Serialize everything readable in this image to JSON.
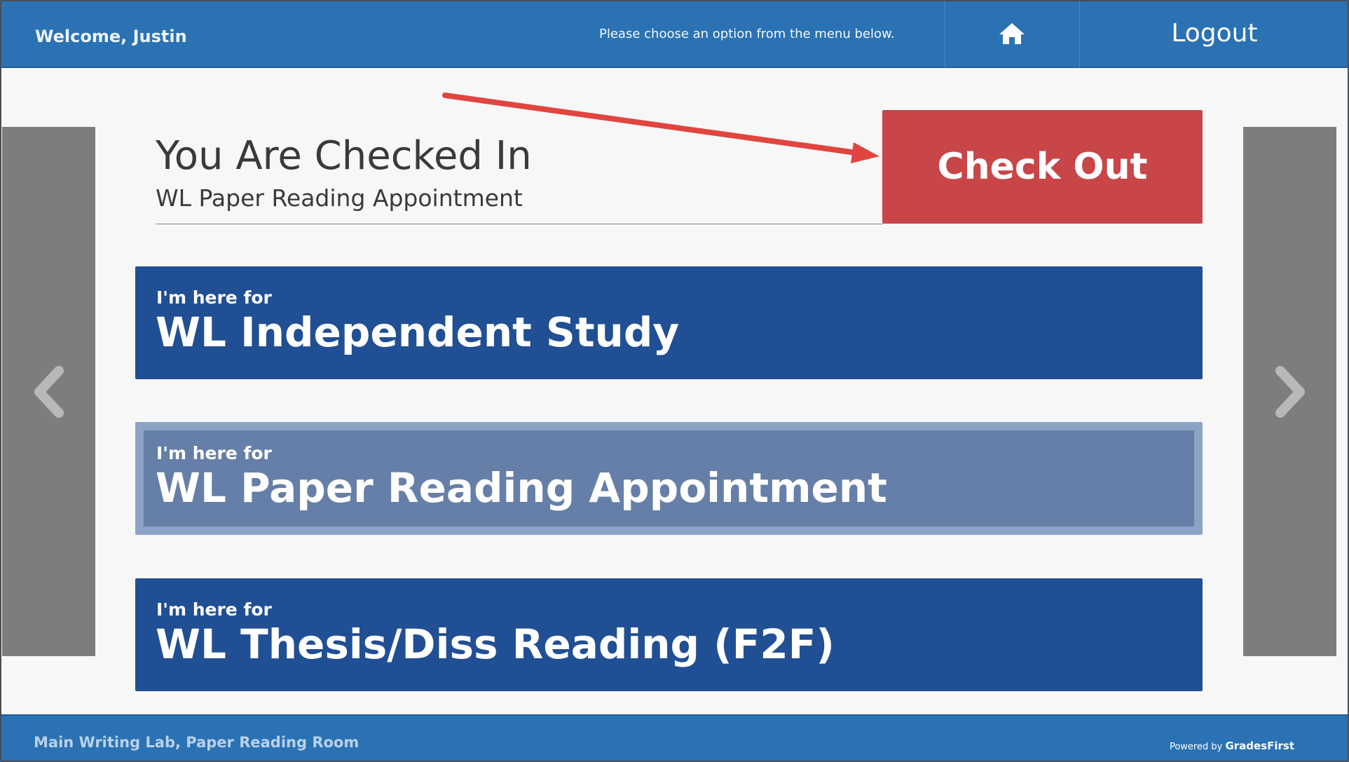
{
  "header": {
    "welcome": "Welcome, Justin",
    "instructions": "Please choose an option from the menu below.",
    "home_icon": "home-icon",
    "logout_label": "Logout"
  },
  "status": {
    "title": "You Are Checked In",
    "subtitle": "WL Paper Reading Appointment",
    "checkout_label": "Check Out"
  },
  "options": [
    {
      "prefix": "I'm here for",
      "title": "WL Independent Study",
      "selected": false
    },
    {
      "prefix": "I'm here for",
      "title": "WL Paper Reading Appointment",
      "selected": true
    },
    {
      "prefix": "I'm here for",
      "title": "WL Thesis/Diss Reading (F2F)",
      "selected": false
    }
  ],
  "nav": {
    "prev_icon": "chevron-left-icon",
    "next_icon": "chevron-right-icon"
  },
  "footer": {
    "location": "Main Writing Lab, Paper Reading Room",
    "powered_prefix": "Powered by",
    "powered_brand": "GradesFirst"
  },
  "colors": {
    "header_bg": "#2a72b4",
    "option_bg": "#214f94",
    "option_selected_bg": "#667fa8",
    "checkout_bg": "#c84648",
    "nav_panel_bg": "#7d7d7d",
    "annotation_arrow": "#e0463f"
  }
}
